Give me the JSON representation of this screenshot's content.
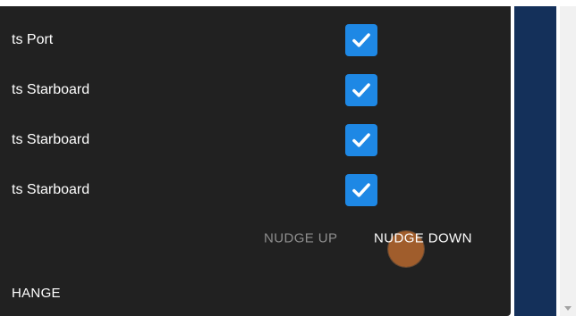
{
  "rows": [
    {
      "label": "ts Port",
      "checked": true
    },
    {
      "label": "ts Starboard",
      "checked": true
    },
    {
      "label": "ts Starboard",
      "checked": true
    },
    {
      "label": "ts Starboard",
      "checked": true
    }
  ],
  "actions": {
    "nudge_up": "NUDGE UP",
    "nudge_down": "NUDGE DOWN"
  },
  "footer": {
    "label": "HANGE"
  },
  "icons": {
    "checkbox": "check-icon",
    "scroll": "scroll-down-arrow-icon"
  },
  "colors": {
    "dialog_bg": "#212121",
    "checkbox_accent": "#1e88e5",
    "side_panel": "#14305a",
    "ripple": "#c46e30"
  }
}
